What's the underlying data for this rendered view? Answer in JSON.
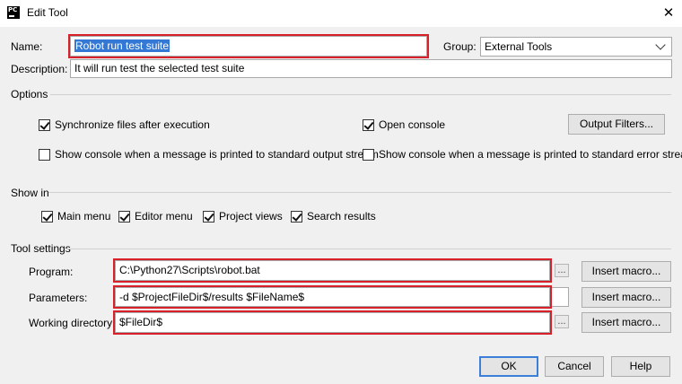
{
  "window": {
    "title": "Edit Tool",
    "app_icon_text": "PC",
    "close_glyph": "✕"
  },
  "form": {
    "name_label": "Name:",
    "name_value": "Robot run test suite",
    "group_label": "Group:",
    "group_value": "External Tools",
    "description_label": "Description:",
    "description_value": "It will run test the selected test suite"
  },
  "options": {
    "title": "Options",
    "sync_files": {
      "label": "Synchronize files after execution",
      "checked": true
    },
    "open_console": {
      "label": "Open console",
      "checked": true
    },
    "output_filters_button": "Output Filters...",
    "show_console_stdout": {
      "label": "Show console when a message is printed to standard output stream",
      "checked": false
    },
    "show_console_stderr": {
      "label": "Show console when a message is printed to standard error stream",
      "checked": false
    }
  },
  "show_in": {
    "title": "Show in",
    "main_menu": {
      "label": "Main menu",
      "checked": true
    },
    "editor_menu": {
      "label": "Editor menu",
      "checked": true
    },
    "project_views": {
      "label": "Project views",
      "checked": true
    },
    "search_results": {
      "label": "Search results",
      "checked": true
    }
  },
  "tool_settings": {
    "title": "Tool settings",
    "program_label": "Program:",
    "program_value": "C:\\Python27\\Scripts\\robot.bat",
    "parameters_label": "Parameters:",
    "parameters_value": "-d $ProjectFileDir$/results $FileName$",
    "working_dir_label": "Working directory:",
    "working_dir_value": "$FileDir$",
    "browse_glyph": "...",
    "insert_macro_button": "Insert macro..."
  },
  "footer": {
    "ok": "OK",
    "cancel": "Cancel",
    "help": "Help"
  },
  "colors": {
    "highlight_border": "#d8202a",
    "selection": "#3378d4",
    "primary_border": "#3c7fd8"
  }
}
